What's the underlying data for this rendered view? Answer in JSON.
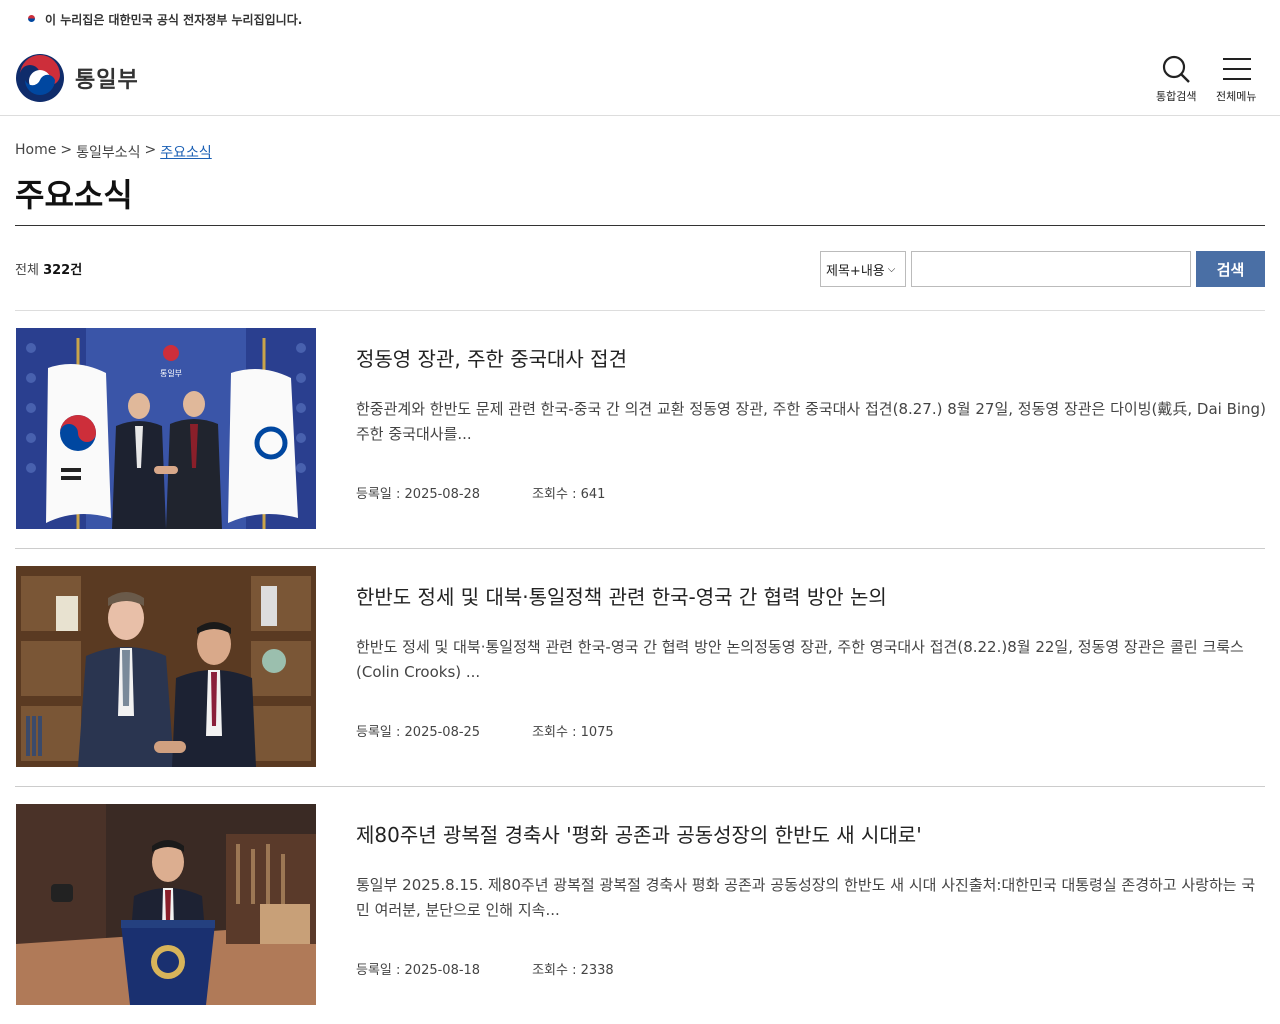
{
  "banner": {
    "text": "이 누리집은 대한민국 공식 전자정부 누리집입니다."
  },
  "header": {
    "logo_text": "통일부",
    "search_label": "통합검색",
    "menu_label": "전체메뉴"
  },
  "breadcrumb": {
    "home": "Home",
    "sep1": ">",
    "parent": "통일부소식",
    "sep2": ">",
    "current": "주요소식"
  },
  "page_title": "주요소식",
  "toolbar": {
    "total_prefix": "전체",
    "total_count": "322건",
    "select_value": "제목+내용",
    "search_value": "",
    "search_button": "검색"
  },
  "colors": {
    "accent": "#4a6fa5",
    "link": "#1a5fb4"
  },
  "items": [
    {
      "title": "정동영 장관, 주한 중국대사 접견",
      "summary": "한중관계와 한반도 문제 관련 한국-중국 간 의견 교환 정동영 장관, 주한 중국대사 접견(8.27.) 8월 27일, 정동영 장관은 다이빙(戴兵, Dai Bing) 주한 중국대사를...",
      "date": "등록일 : 2025-08-28",
      "views": "조회수 : 641",
      "thumb_text": "통일부"
    },
    {
      "title": "한반도 정세 및 대북·통일정책 관련 한국-영국 간 협력 방안 논의",
      "summary": "한반도 정세 및 대북·통일정책 관련 한국-영국 간 협력 방안 논의정동영 장관, 주한 영국대사 접견(8.22.)8월 22일, 정동영 장관은 콜린 크룩스(Colin Crooks) ...",
      "date": "등록일 : 2025-08-25",
      "views": "조회수 : 1075"
    },
    {
      "title": "제80주년 광복절 경축사 '평화 공존과 공동성장의 한반도 새 시대로'",
      "summary": "통일부 2025.8.15. 제80주년 광복절 광복절 경축사 평화 공존과 공동성장의 한반도 새 시대 사진출처:대한민국 대통령실 존경하고 사랑하는 국민 여러분, 분단으로 인해 지속...",
      "date": "등록일 : 2025-08-18",
      "views": "조회수 : 2338"
    }
  ]
}
